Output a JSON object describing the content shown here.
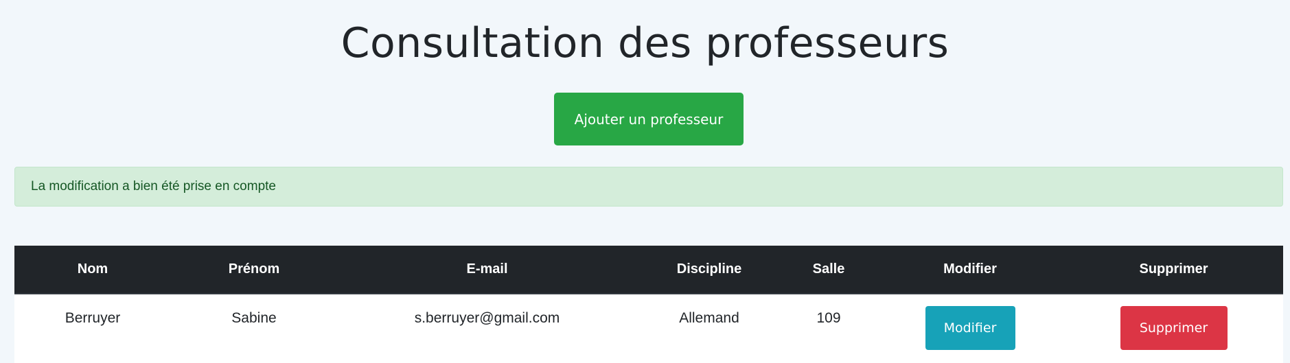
{
  "header": {
    "title": "Consultation des professeurs",
    "add_button_label": "Ajouter un professeur"
  },
  "alert": {
    "message": "La modification a bien été prise en compte"
  },
  "table": {
    "columns": [
      "Nom",
      "Prénom",
      "E-mail",
      "Discipline",
      "Salle",
      "Modifier",
      "Supprimer"
    ],
    "rows": [
      {
        "nom": "Berruyer",
        "prenom": "Sabine",
        "email": "s.berruyer@gmail.com",
        "discipline": "Allemand",
        "salle": "109",
        "edit_label": "Modifier",
        "delete_label": "Supprimer"
      }
    ]
  },
  "colors": {
    "success": "#28a745",
    "info": "#17a2b8",
    "danger": "#dc3545",
    "table_header": "#212529",
    "alert_bg": "#d4edda"
  }
}
